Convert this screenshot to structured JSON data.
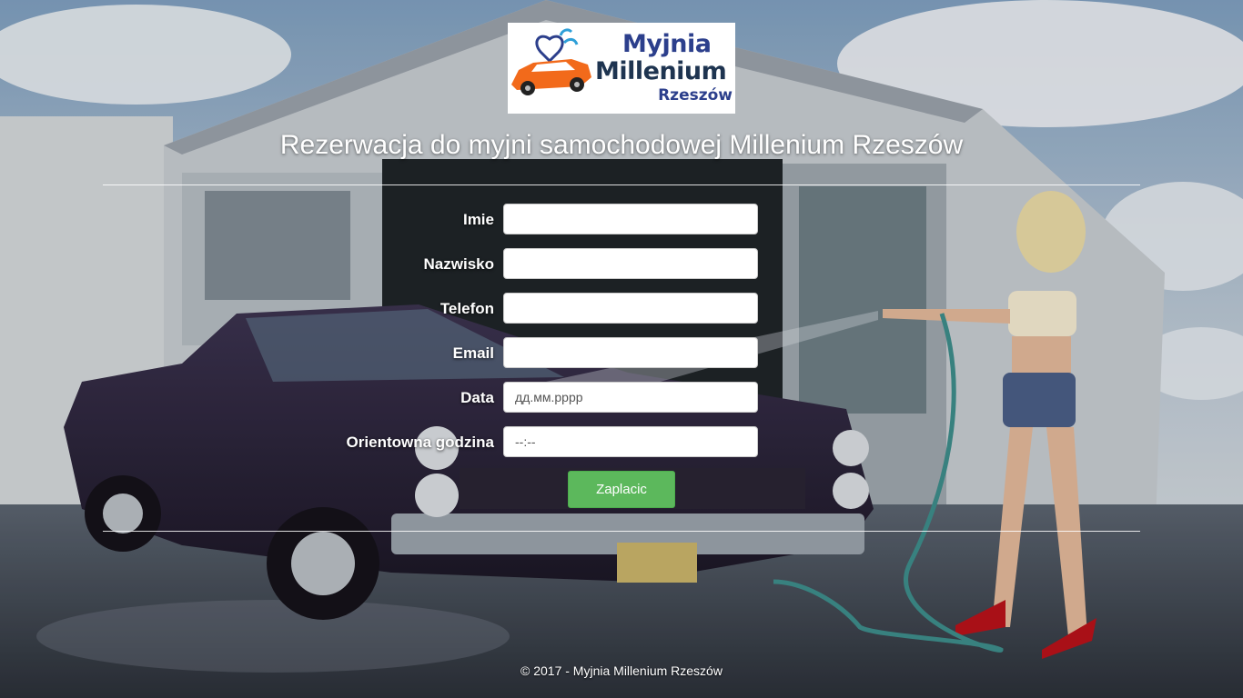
{
  "logo": {
    "line1": "Myjnia",
    "line2": "Millenium",
    "line3": "Rzeszów"
  },
  "page": {
    "title": "Rezerwacja do myjni samochodowej Millenium Rzeszów"
  },
  "form": {
    "fields": [
      {
        "label": "Imie",
        "value": "",
        "placeholder": ""
      },
      {
        "label": "Nazwisko",
        "value": "",
        "placeholder": ""
      },
      {
        "label": "Telefon",
        "value": "",
        "placeholder": ""
      },
      {
        "label": "Email",
        "value": "",
        "placeholder": ""
      },
      {
        "label": "Data",
        "value": "",
        "placeholder": "дд.мм.рррр"
      },
      {
        "label": "Orientowna godzina",
        "value": "",
        "placeholder": "--:--"
      }
    ],
    "submit_label": "Zaplacic"
  },
  "footer": {
    "text": "© 2017 - Myjnia Millenium Rzeszów"
  },
  "colors": {
    "submit_bg": "#5cb85c",
    "logo_blue": "#2c3f8c",
    "logo_car": "#f26a1b",
    "logo_water": "#2e9fd8"
  }
}
